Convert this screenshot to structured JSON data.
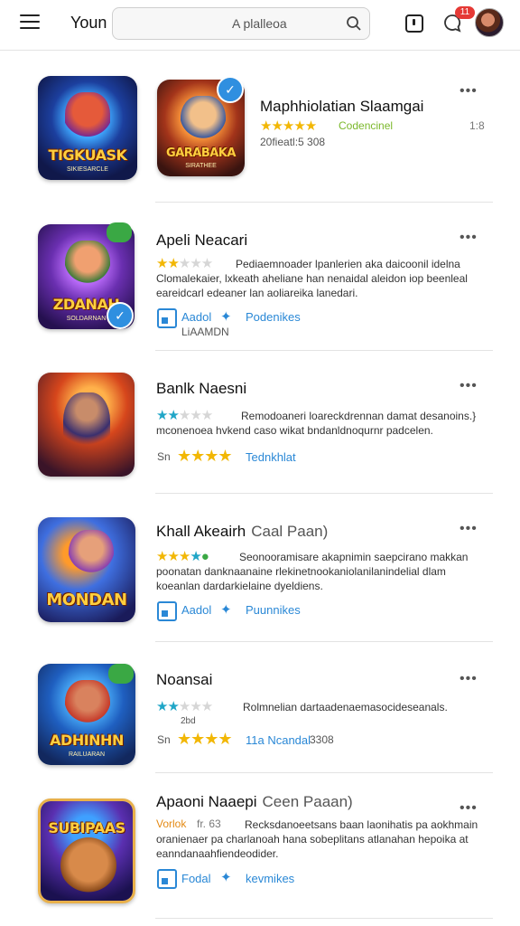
{
  "header": {
    "brand": "Youn",
    "search_placeholder": "A plalleoa",
    "notif_count": "11"
  },
  "items": [
    {
      "title": "Maphhiolatian Slaamgai",
      "rating_label": "Codencinel",
      "date": "20fieatl:5 308",
      "side": "1:8",
      "thumb_title": "TIGKUASK",
      "thumb_sub": "SIKIESARCLE",
      "thumb2_title": "GARABAKA",
      "thumb2_sub": "SIRATHEE"
    },
    {
      "title": "Apeli Neacari",
      "desc": "Pediaemnoader lpanlerien aka daicoonil idelna Clomalekaier, lxkeath aheliane han nenaidal aleidon iop beenleal eareidcarl edeaner lan aoliareika lanedari.",
      "tag": "Aadol",
      "tag_extra": "Podenikes",
      "tag_sub": "LiAAMDN",
      "thumb_title": "ZDANAH",
      "thumb_sub": "SOLDARNAN"
    },
    {
      "title": "Banlk Naesni",
      "desc": "Remodoaneri loareckdrennan damat desanoins.} mconenoea hvkend caso wikat bndanldnoqurnr padcelen.",
      "meta_prefix": "Sn",
      "tag": "Tednkhlat",
      "thumb_title": "",
      "thumb_sub": ""
    },
    {
      "title": "Khall Akeairh",
      "title_aside": "Caal Paan)",
      "desc": "Seonooramisare akapnimin saepcirano makkan poonatan danknaanaine rlekinetnookaniolanilanindelial dlam koeanlan dardarkielaine dyeldiens.",
      "tag": "Aadol",
      "tag_extra": "Puunnikes",
      "thumb_title": "MONDAN",
      "thumb_sub": ""
    },
    {
      "title": "Noansai",
      "desc": "Rolmnelian dartaadenaemasocideseanals.",
      "desc2": "2bd",
      "meta_prefix": "Sn",
      "meta_link": "11a Ncandal",
      "meta_suffix": "3308",
      "thumb_title": "ADHINHN",
      "thumb_sub": "RAILUARAN"
    },
    {
      "title": "Apaoni Naaepi",
      "title_aside": "Ceen Paaan)",
      "desc_lead": "Vorlok",
      "desc_num": "fr. 63",
      "desc": "Recksdanoeetsans baan laonihatis pa aokhmain oranienaer pa charlanoah hana sobeplitans atlanahan hepoika at eanndanaahfiendeodider.",
      "tag": "Fodal",
      "tag_extra": "kevmikes",
      "thumb_title": "SUBIPAAS",
      "thumb_sub": ""
    }
  ],
  "colors": {
    "accent": "#2a88d6",
    "star": "#f2b705",
    "star_teal": "#20a6c7",
    "badge": "#e53935"
  }
}
